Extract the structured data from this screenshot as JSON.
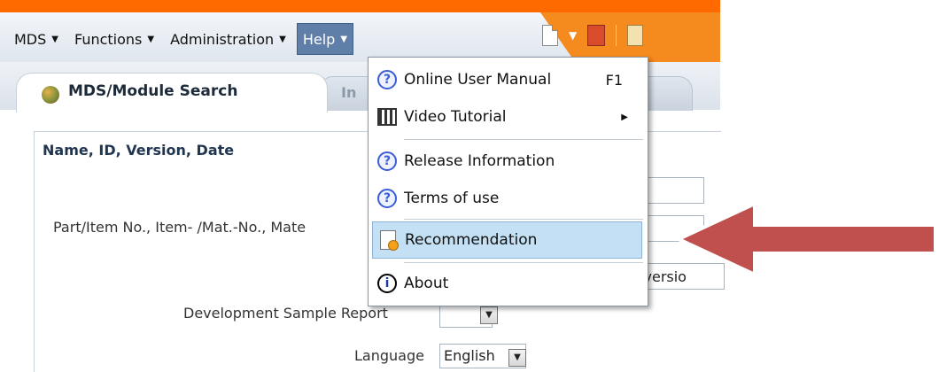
{
  "menubar": {
    "items": [
      {
        "label": "MDS"
      },
      {
        "label": "Functions"
      },
      {
        "label": "Administration"
      },
      {
        "label": "Help"
      }
    ]
  },
  "tabs": {
    "active": "MDS/Module Search",
    "inactive_partial": "In"
  },
  "panel": {
    "title": "Name, ID, Version, Date",
    "part_label": "Part/Item No., Item- /Mat.-No., Mate",
    "version_partial": "nt versio",
    "dev_sample_label": "Development Sample Report",
    "language_label": "Language",
    "language_value": "English"
  },
  "help_menu": {
    "online_manual": "Online User Manual",
    "online_manual_shortcut": "F1",
    "video_tutorial": "Video Tutorial",
    "release_info": "Release Information",
    "terms": "Terms of use",
    "recommendation": "Recommendation",
    "about": "About"
  },
  "colors": {
    "orange": "#f58a1f",
    "help_active": "#5f7fa8",
    "hover": "#c4e0f4",
    "arrow": "#c0504d"
  },
  "icons": [
    "question-icon",
    "video-icon",
    "recommendation-icon",
    "info-icon",
    "new-document-icon",
    "save-icon",
    "edit-icon"
  ]
}
